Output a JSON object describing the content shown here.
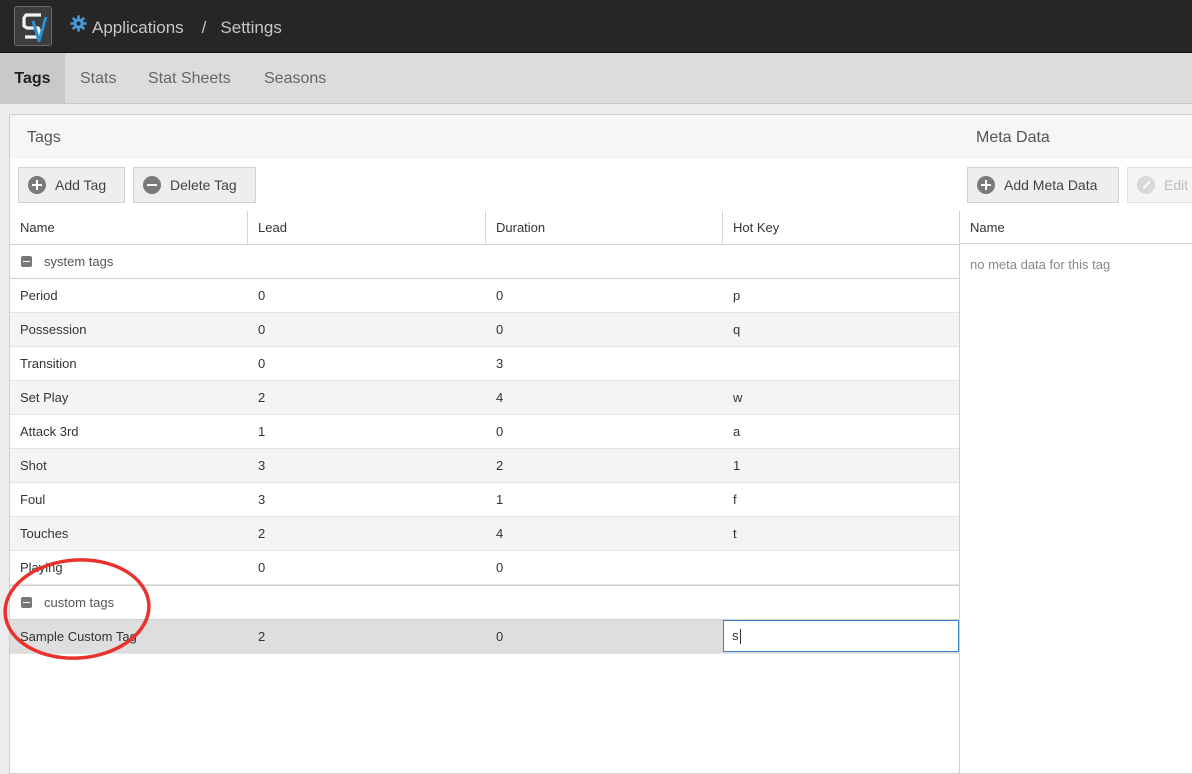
{
  "breadcrumb": {
    "app": "Applications",
    "separator": "/",
    "page": "Settings"
  },
  "tabs": [
    {
      "label": "Tags",
      "active": true
    },
    {
      "label": "Stats"
    },
    {
      "label": "Stat Sheets"
    },
    {
      "label": "Seasons"
    }
  ],
  "tags_panel": {
    "title": "Tags",
    "add_label": "Add Tag",
    "delete_label": "Delete Tag",
    "columns": [
      "Name",
      "Lead",
      "Duration",
      "Hot Key"
    ],
    "groups": [
      {
        "label": "system tags",
        "rows": [
          {
            "name": "Period",
            "lead": "0",
            "duration": "0",
            "hotkey": "p"
          },
          {
            "name": "Possession",
            "lead": "0",
            "duration": "0",
            "hotkey": "q"
          },
          {
            "name": "Transition",
            "lead": "0",
            "duration": "3",
            "hotkey": ""
          },
          {
            "name": "Set Play",
            "lead": "2",
            "duration": "4",
            "hotkey": "w"
          },
          {
            "name": "Attack 3rd",
            "lead": "1",
            "duration": "0",
            "hotkey": "a"
          },
          {
            "name": "Shot",
            "lead": "3",
            "duration": "2",
            "hotkey": "1"
          },
          {
            "name": "Foul",
            "lead": "3",
            "duration": "1",
            "hotkey": "f"
          },
          {
            "name": "Touches",
            "lead": "2",
            "duration": "4",
            "hotkey": "t"
          },
          {
            "name": "Playing",
            "lead": "0",
            "duration": "0",
            "hotkey": ""
          }
        ]
      },
      {
        "label": "custom tags",
        "rows": [
          {
            "name": "Sample Custom Tag",
            "lead": "2",
            "duration": "0",
            "hotkey": "s"
          }
        ]
      }
    ]
  },
  "meta_panel": {
    "title": "Meta Data",
    "add_label": "Add Meta Data",
    "edit_label": "Edit",
    "column": "Name",
    "empty_text": "no meta data for this tag"
  },
  "colors": {
    "topbar": "#262626",
    "accent": "#3b7fc4",
    "annotation": "#e8322b"
  },
  "icons": [
    "app-logo-icon",
    "gear-icon",
    "add-icon",
    "remove-icon",
    "collapse-icon",
    "edit-icon"
  ]
}
